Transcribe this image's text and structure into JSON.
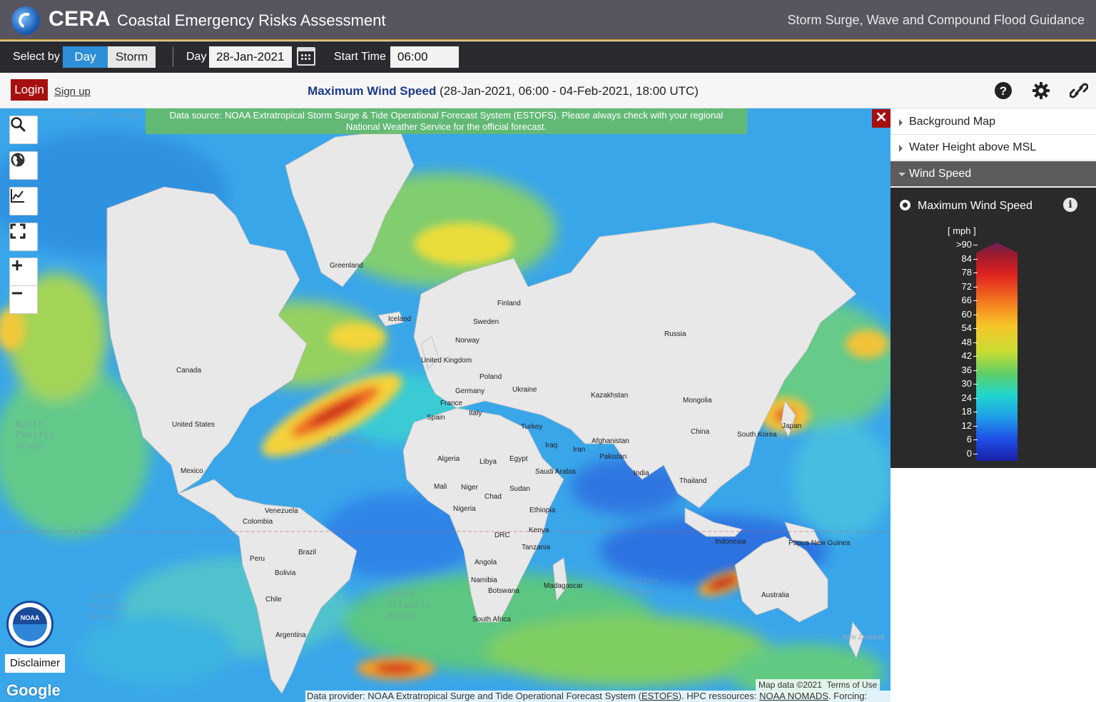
{
  "header": {
    "brand": "CERA",
    "brand_sub": "Coastal Emergency Risks Assessment",
    "tagline": "Storm Surge, Wave and Compound Flood Guidance"
  },
  "toolbar": {
    "select_by_label": "Select by",
    "day_btn": "Day",
    "storm_btn": "Storm",
    "day_label": "Day",
    "day_value": "28-Jan-2021",
    "start_time_label": "Start Time",
    "start_time_value": "06:00 UTC"
  },
  "subbar": {
    "login": "Login",
    "signup": "Sign up",
    "title_bold": "Maximum Wind Speed",
    "title_rest": " (28-Jan-2021, 06:00 - 04-Feb-2021, 18:00 UTC)"
  },
  "map": {
    "datasource_line1": "Data source: NOAA Extratropical Storm Surge & Tide Operational Forecast System (ESTOFS). Please always check with your regional",
    "datasource_line2": "National Weather Service for the official forecast.",
    "close": "✕",
    "disclaimer": "Disclaimer",
    "noaa": "NOAA",
    "google": "Google",
    "map_data": "Map data ©2021",
    "terms": "Terms of Use",
    "provider_prefix": "Data provider: NOAA Extratropical Surge and Tide Operational Forecast System (",
    "provider_estofs": "ESTOFS",
    "provider_mid": "). HPC ressources: ",
    "provider_nomads": "NOAA NOMADS",
    "provider_suffix": ". Forcing: GFS.",
    "countries": [
      "Greenland",
      "Canada",
      "United States",
      "Mexico",
      "Venezuela",
      "Colombia",
      "Peru",
      "Brazil",
      "Bolivia",
      "Chile",
      "Argentina",
      "Iceland",
      "Finland",
      "Sweden",
      "Norway",
      "United Kingdom",
      "Poland",
      "Germany",
      "Ukraine",
      "France",
      "Spain",
      "Italy",
      "Russia",
      "Kazakhstan",
      "Mongolia",
      "China",
      "South Korea",
      "Japan",
      "Turkey",
      "Afghanistan",
      "Iraq",
      "Iran",
      "Pakistan",
      "India",
      "Thailand",
      "Algeria",
      "Libya",
      "Egypt",
      "Saudi Arabia",
      "Mali",
      "Niger",
      "Sudan",
      "Chad",
      "Nigeria",
      "Ethiopia",
      "Kenya",
      "DRC",
      "Tanzania",
      "Angola",
      "Namibia",
      "Botswana",
      "Madagascar",
      "South Africa",
      "Indonesia",
      "Papua New Guinea",
      "Australia",
      "New Zealand"
    ],
    "oceans": [
      "Arctic Ocean",
      "North Pacific Ocean",
      "Atlantic Ocean",
      "South Pacific Ocean",
      "South Atlantic Ocean",
      "Indian Ocean"
    ]
  },
  "panel": {
    "acc_background": "Background Map",
    "acc_water": "Water Height above MSL",
    "acc_wind": "Wind Speed",
    "layer_label": "Maximum Wind Speed",
    "unit": "[ mph ]",
    "ticks": [
      ">90",
      "84",
      "78",
      "72",
      "66",
      "60",
      "54",
      "48",
      "42",
      "36",
      "30",
      "24",
      "18",
      "12",
      "6",
      "0"
    ]
  },
  "colors": {
    "header_bg": "#575660",
    "toolbar_bg": "#2b2b2f",
    "day_active": "#2e8fd8",
    "login_bg": "#a60f0f",
    "title_blue": "#1b3a8a",
    "panel_dark": "#2a2a2a"
  }
}
